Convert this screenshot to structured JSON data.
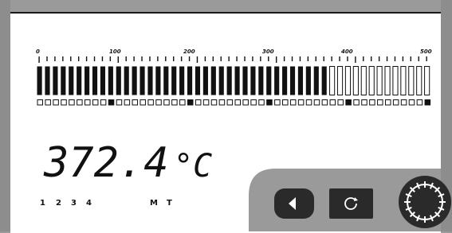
{
  "scale": {
    "labels": [
      "0",
      "100",
      "200",
      "300",
      "400",
      "500"
    ],
    "min": 0,
    "max": 500
  },
  "bar": {
    "total_segments": 50,
    "filled_segments": 37,
    "value_fraction": 0.744
  },
  "reading": {
    "value": "372.4",
    "unit": "°C"
  },
  "channels": {
    "labels": [
      "1",
      "2",
      "3",
      "4",
      "M",
      "T"
    ]
  },
  "buttons": {
    "back_icon": "left-triangle-icon",
    "refresh_icon": "refresh-icon",
    "dial_icon": "dial-icon"
  },
  "colors": {
    "bar_fill": "#111111",
    "panel_bg": "#9a9a9a",
    "button_bg": "#2a2a2a"
  }
}
